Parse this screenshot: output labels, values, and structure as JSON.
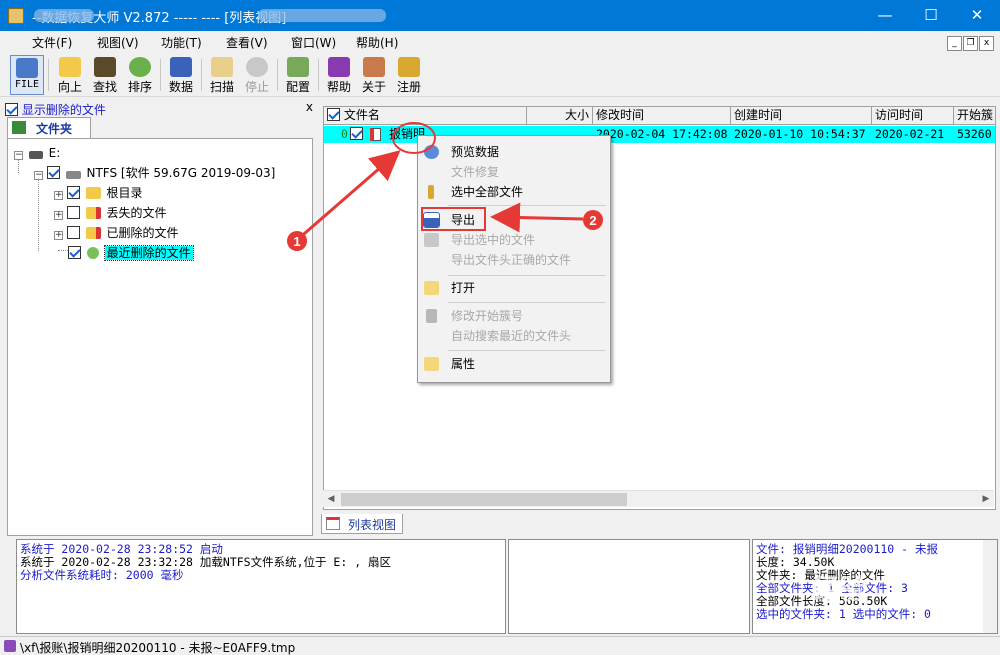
{
  "window": {
    "title": "--数据恢复大师 V2.872  -----                          ---- [列表视图]",
    "controls": {
      "minimize": "—",
      "maximize": "☐",
      "close": "✕"
    }
  },
  "menubar": {
    "items": [
      "文件(F)",
      "视图(V)",
      "功能(T)",
      "查看(V)",
      "窗口(W)",
      "帮助(H)"
    ],
    "mdi": {
      "minimize": "_",
      "restore": "❐",
      "close": "x"
    }
  },
  "toolbar": {
    "buttons": [
      {
        "label": "FILE",
        "icon": "file-icon",
        "state": "active"
      },
      {
        "label": "向上",
        "icon": "folder-up-icon"
      },
      {
        "label": "查找",
        "icon": "binoculars-icon"
      },
      {
        "label": "排序",
        "icon": "sort-icon"
      },
      {
        "label": "数据",
        "icon": "disk-icon"
      },
      {
        "label": "扫描",
        "icon": "scan-icon"
      },
      {
        "label": "停止",
        "icon": "stop-icon",
        "state": "disabled"
      },
      {
        "label": "配置",
        "icon": "config-icon"
      },
      {
        "label": "帮助",
        "icon": "help-book-icon"
      },
      {
        "label": "关于",
        "icon": "house-icon"
      },
      {
        "label": "注册",
        "icon": "key-icon"
      }
    ]
  },
  "left_pane": {
    "show_deleted_label": "显示删除的文件",
    "show_deleted_checked": true,
    "close": "x",
    "tab_label": "文件夹",
    "tree": {
      "drive": "E:",
      "volume": "NTFS [软件 59.67G 2019-09-03]",
      "children": [
        {
          "label": "根目录",
          "checked": true
        },
        {
          "label": "丢失的文件",
          "checked": false
        },
        {
          "label": "已删除的文件",
          "checked": false
        },
        {
          "label": "最近删除的文件",
          "checked": true,
          "selected": true
        }
      ]
    }
  },
  "file_list": {
    "columns": [
      "文件名",
      "大小",
      "修改时间",
      "创建时间",
      "访问时间",
      "开始簇"
    ],
    "rows": [
      {
        "index": "0",
        "checked": true,
        "name": "报销明",
        "size": "",
        "modified": "2020-02-04 17:42:08",
        "created": "2020-01-10 10:54:37",
        "accessed": "2020-02-21",
        "start_cluster": "53260"
      }
    ],
    "tab_label": "列表视图"
  },
  "context_menu": {
    "items": [
      {
        "label": "预览数据",
        "icon": "preview-icon",
        "enabled": true
      },
      {
        "label": "文件修复",
        "icon": "",
        "enabled": false
      },
      {
        "label": "选中全部文件",
        "icon": "pin-icon",
        "enabled": true
      },
      {
        "label": "导出",
        "icon": "floppy-icon",
        "enabled": true,
        "highlighted": true
      },
      {
        "label": "导出选中的文件",
        "icon": "floppy-gray-icon",
        "enabled": false
      },
      {
        "label": "导出文件头正确的文件",
        "icon": "",
        "enabled": false
      },
      {
        "label": "打开",
        "icon": "open-icon",
        "enabled": true
      },
      {
        "label": "修改开始簇号",
        "icon": "edit-gray-icon",
        "enabled": false
      },
      {
        "label": "自动搜索最近的文件头",
        "icon": "",
        "enabled": false
      },
      {
        "label": "属性",
        "icon": "properties-icon",
        "enabled": true
      }
    ]
  },
  "annotations": [
    {
      "number": "1",
      "color": "#e53935"
    },
    {
      "number": "2",
      "color": "#e53935"
    }
  ],
  "log": {
    "lines": [
      {
        "text": "系统于 2020-02-28 23:28:52 启动",
        "color": "blue"
      },
      {
        "text": "系统于 2020-02-28 23:32:28 加载NTFS文件系统,位于 E: ,   扇区",
        "color": "black"
      },
      {
        "text": "分析文件系统耗时: 2000 毫秒",
        "color": "blue"
      }
    ]
  },
  "info_pane": {
    "lines": [
      {
        "text": "文件: 报销明细20200110 - 未报",
        "color": "blue"
      },
      {
        "text": "长度: 34.50K",
        "color": "black"
      },
      {
        "text": "",
        "color": "black"
      },
      {
        "text": "文件夹: 最近删除的文件",
        "color": "black"
      },
      {
        "text": "全部文件夹: 1  全部文件: 3",
        "color": "blue"
      },
      {
        "text": "  全部文件长度: 568.50K",
        "color": "black"
      },
      {
        "text": "选中的文件夹: 1  选中的文件: 0",
        "color": "blue"
      }
    ]
  },
  "statusbar": {
    "text": "\\xf\\报账\\报销明细20200110 - 未报~E0AFF9.tmp"
  },
  "watermark": "经验"
}
